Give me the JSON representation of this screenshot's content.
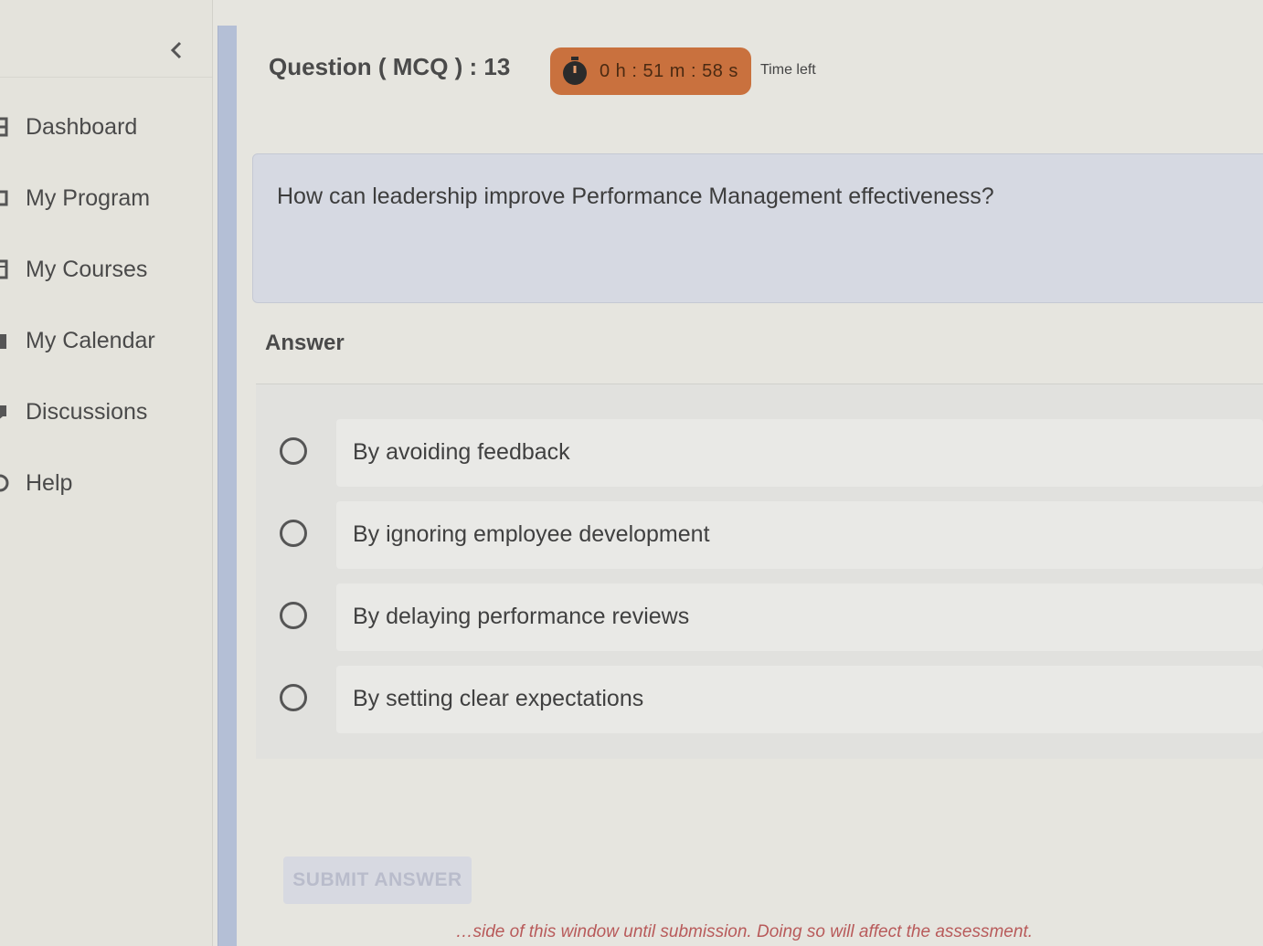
{
  "sidebar": {
    "items": [
      {
        "label": "Dashboard",
        "icon": "dashboard-icon"
      },
      {
        "label": "My Program",
        "icon": "program-icon"
      },
      {
        "label": "My Courses",
        "icon": "courses-icon"
      },
      {
        "label": "My Calendar",
        "icon": "calendar-icon"
      },
      {
        "label": "Discussions",
        "icon": "discussions-icon"
      },
      {
        "label": "Help",
        "icon": "help-icon"
      }
    ],
    "collapse_icon": "chevron-left-icon"
  },
  "question": {
    "title": "Question ( MCQ ) : 13",
    "timer": "0 h : 51 m : 58 s",
    "time_left_label": "Time left",
    "text": "How can leadership improve Performance Management effectiveness?"
  },
  "answer": {
    "heading": "Answer",
    "options": [
      "By avoiding feedback",
      "By ignoring employee development",
      "By delaying performance reviews",
      "By setting clear expectations"
    ]
  },
  "submit_label": "SUBMIT ANSWER",
  "warning_text": "…side of this window until submission. Doing so will affect the assessment.",
  "colors": {
    "timer_bg": "#c9713e",
    "accent_bar": "#b4bfd6",
    "warning": "#b85a5a"
  }
}
